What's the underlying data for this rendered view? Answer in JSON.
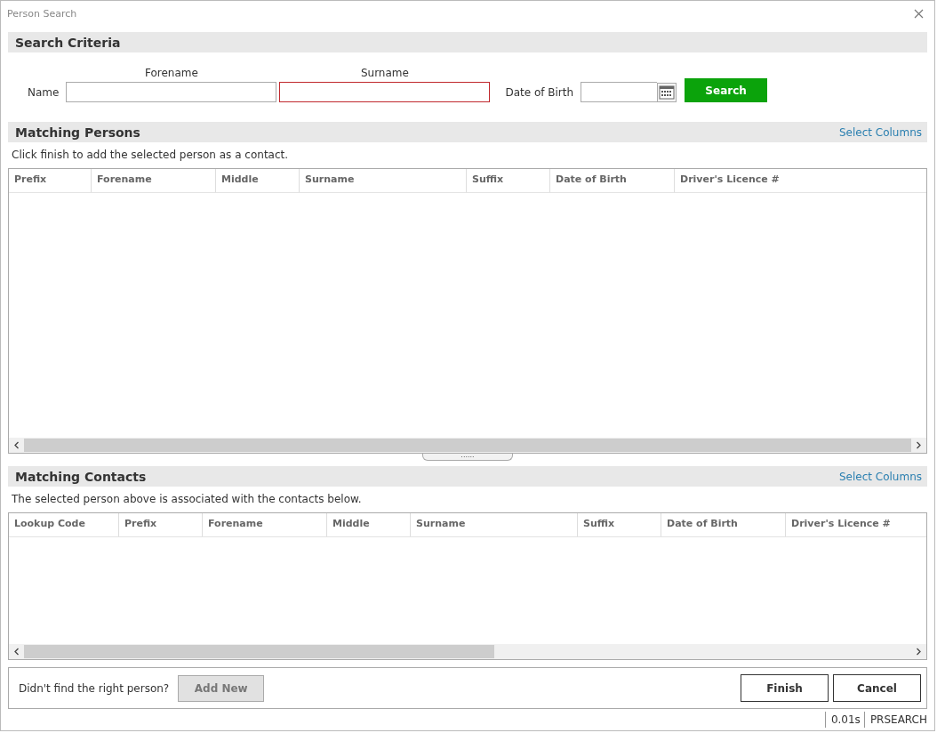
{
  "window": {
    "title": "Person Search"
  },
  "search_criteria": {
    "heading": "Search Criteria",
    "name_label": "Name",
    "forename": {
      "label": "Forename",
      "error": false
    },
    "surname": {
      "label": "Surname",
      "error": true
    },
    "dob": {
      "label": "Date of Birth"
    },
    "search_button": "Search"
  },
  "matching_persons": {
    "heading": "Matching Persons",
    "select_columns": "Select Columns",
    "hint": "Click finish to add the selected person as a contact.",
    "columns": [
      "Prefix",
      "Forename",
      "Middle",
      "Surname",
      "Suffix",
      "Date of Birth",
      "Driver's Licence #"
    ]
  },
  "splitter": {
    "grip": "......"
  },
  "matching_contacts": {
    "heading": "Matching Contacts",
    "select_columns": "Select Columns",
    "hint": "The selected person above is associated with the contacts below.",
    "columns": [
      "Lookup Code",
      "Prefix",
      "Forename",
      "Middle",
      "Surname",
      "Suffix",
      "Date of Birth",
      "Driver's Licence #"
    ]
  },
  "footer": {
    "prompt": "Didn't find the right person?",
    "add_new": {
      "label": "Add New",
      "disabled": true
    },
    "finish": "Finish",
    "cancel": "Cancel"
  },
  "status_bar": [
    "0.01s",
    "PRSEARCH"
  ]
}
